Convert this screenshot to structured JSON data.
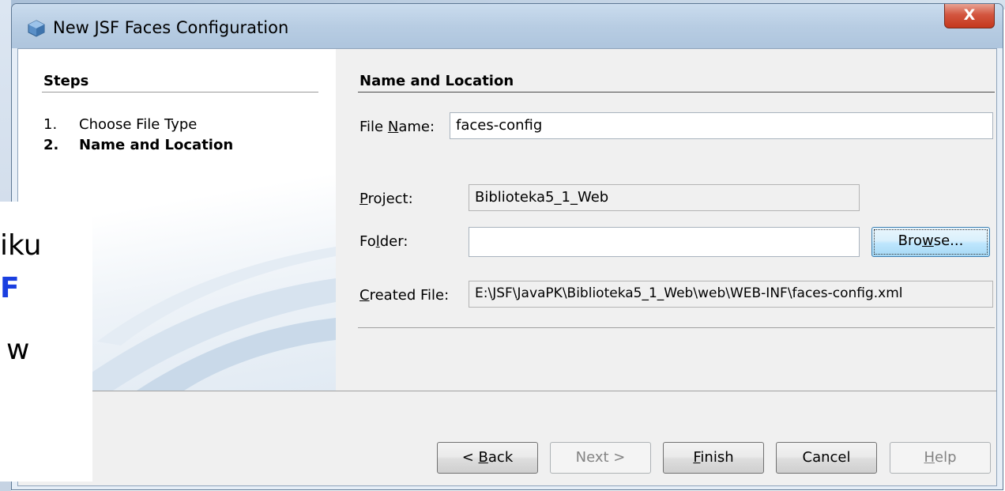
{
  "window": {
    "title": "New JSF Faces Configuration",
    "close_label": "X"
  },
  "steps": {
    "heading": "Steps",
    "items": [
      {
        "num": "1.",
        "label": "Choose File Type"
      },
      {
        "num": "2.",
        "label": "Name and Location"
      }
    ]
  },
  "panel": {
    "heading": "Name and Location",
    "file_name": {
      "pre": "File ",
      "mnemonic": "N",
      "post": "ame:",
      "value": "faces-config"
    },
    "project": {
      "pre": "",
      "mnemonic": "P",
      "post": "roject:",
      "value": "Biblioteka5_1_Web"
    },
    "folder": {
      "pre": "Fo",
      "mnemonic": "l",
      "post": "der:",
      "value": ""
    },
    "browse": {
      "pre": "Bro",
      "mnemonic": "w",
      "post": "se..."
    },
    "created_file": {
      "pre": "",
      "mnemonic": "C",
      "post": "reated File:",
      "value": "E:\\JSF\\JavaPK\\Biblioteka5_1_Web\\web\\WEB-INF\\faces-config.xml"
    }
  },
  "buttons": {
    "back": {
      "pre": "< ",
      "mnemonic": "B",
      "post": "ack"
    },
    "next": {
      "label": "Next >"
    },
    "finish": {
      "pre": "",
      "mnemonic": "F",
      "post": "inish"
    },
    "cancel": {
      "label": "Cancel"
    },
    "help": {
      "pre": "",
      "mnemonic": "H",
      "post": "elp"
    }
  },
  "overlay": {
    "line1": "iku",
    "line2": "F",
    "line3": "w"
  }
}
